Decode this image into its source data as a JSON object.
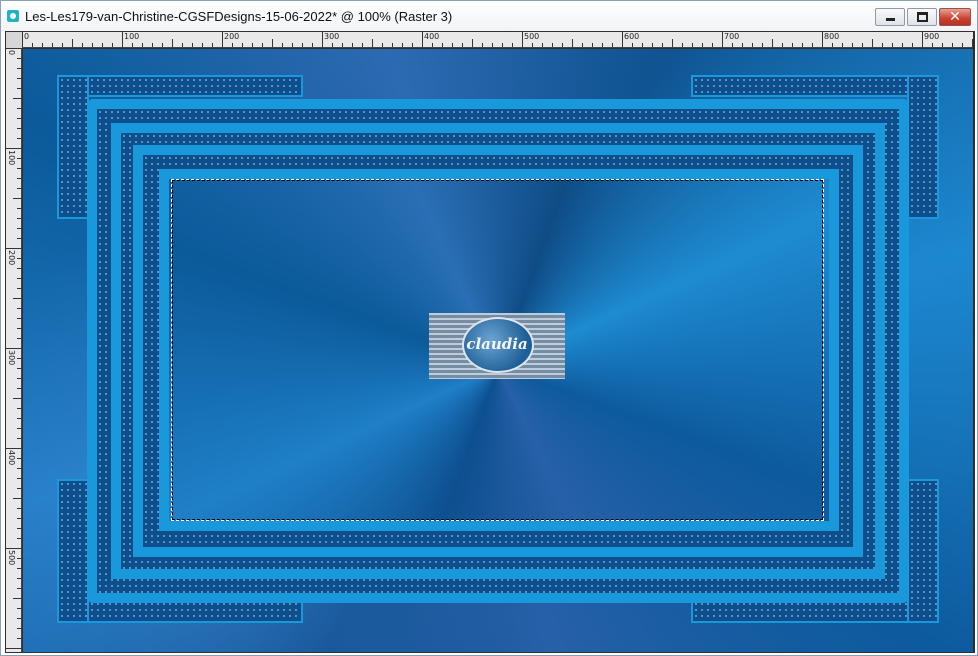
{
  "window": {
    "title": "Les-Les179-van-Christine-CGSFDesigns-15-06-2022* @ 100% (Raster 3)",
    "icon": "app-document-icon",
    "buttons": {
      "minimize": "minimize-icon",
      "maximize": "maximize-icon",
      "close": "close-icon"
    }
  },
  "ruler": {
    "top_labels": [
      "0",
      "100",
      "200",
      "300",
      "400",
      "500",
      "600",
      "700",
      "800",
      "900"
    ],
    "left_labels": [
      "0",
      "100",
      "200",
      "300",
      "400",
      "500"
    ]
  },
  "canvas": {
    "watermark_text": "claudia"
  },
  "colors": {
    "frame_blue": "#1a98dc",
    "dark_blue": "#0c4f8c",
    "close_red": "#c8412e"
  }
}
